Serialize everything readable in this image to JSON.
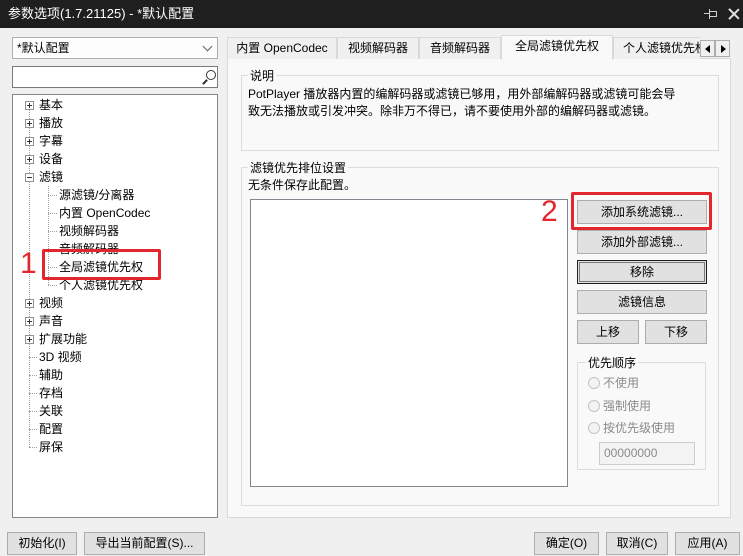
{
  "window": {
    "title": "参数选项(1.7.21125) - *默认配置",
    "pin_icon": "pin-icon",
    "close_icon": "close-icon",
    "title_bar_color": "#1f1f1f"
  },
  "profile_select": {
    "value": "*默认配置",
    "icon": "chevron-down-icon"
  },
  "search": {
    "value": "",
    "icon": "search-icon"
  },
  "tree": {
    "items": [
      {
        "label": "基本",
        "expander": "expand-icon"
      },
      {
        "label": "播放",
        "expander": "expand-icon"
      },
      {
        "label": "字幕",
        "expander": "expand-icon"
      },
      {
        "label": "设备",
        "expander": "expand-icon"
      },
      {
        "label": "滤镜",
        "expander": "collapse-icon"
      },
      {
        "label": "源滤镜/分离器"
      },
      {
        "label": "内置 OpenCodec"
      },
      {
        "label": "视频解码器"
      },
      {
        "label": "音频解码器"
      },
      {
        "label": "全局滤镜优先权",
        "selected": true
      },
      {
        "label": "个人滤镜优先权"
      },
      {
        "label": "视频",
        "expander": "expand-icon"
      },
      {
        "label": "声音",
        "expander": "expand-icon"
      },
      {
        "label": "扩展功能",
        "expander": "expand-icon"
      },
      {
        "label": "3D 视频"
      },
      {
        "label": "辅助"
      },
      {
        "label": "存档"
      },
      {
        "label": "关联"
      },
      {
        "label": "配置"
      },
      {
        "label": "屏保"
      }
    ]
  },
  "tabs": [
    {
      "label": "内置 OpenCodec"
    },
    {
      "label": "视频解码器"
    },
    {
      "label": "音频解码器"
    },
    {
      "label": "全局滤镜优先权",
      "active": true
    },
    {
      "label": "个人滤镜优先权"
    }
  ],
  "tab_scroll": {
    "left_icon": "arrow-left-icon",
    "right_icon": "arrow-right-icon"
  },
  "description": {
    "title": "说明",
    "lines": [
      "PotPlayer 播放器内置的编解码器或滤镜已够用，用外部编解码器或滤镜可能会导",
      "致无法播放或引发冲突。除非万不得已，请不要使用外部的编解码器或滤镜。"
    ]
  },
  "filter_priority": {
    "title": "滤镜优先排位设置",
    "note": "无条件保存此配置。",
    "buttons": {
      "add_system": "添加系统滤镜...",
      "add_external": "添加外部滤镜...",
      "remove": "移除",
      "info": "滤镜信息",
      "move_up": "上移",
      "move_down": "下移"
    },
    "order": {
      "title": "优先顺序",
      "enabled": false,
      "options": [
        {
          "label": "不使用"
        },
        {
          "label": "强制使用"
        },
        {
          "label": "按优先级使用"
        }
      ],
      "value": "00000000"
    }
  },
  "footer": {
    "reset": "初始化(I)",
    "export": "导出当前配置(S)...",
    "ok": "确定(O)",
    "cancel": "取消(C)",
    "apply": "应用(A)"
  },
  "annotations": {
    "marker_1": "1",
    "marker_2": "2",
    "color": "#e3262b"
  }
}
